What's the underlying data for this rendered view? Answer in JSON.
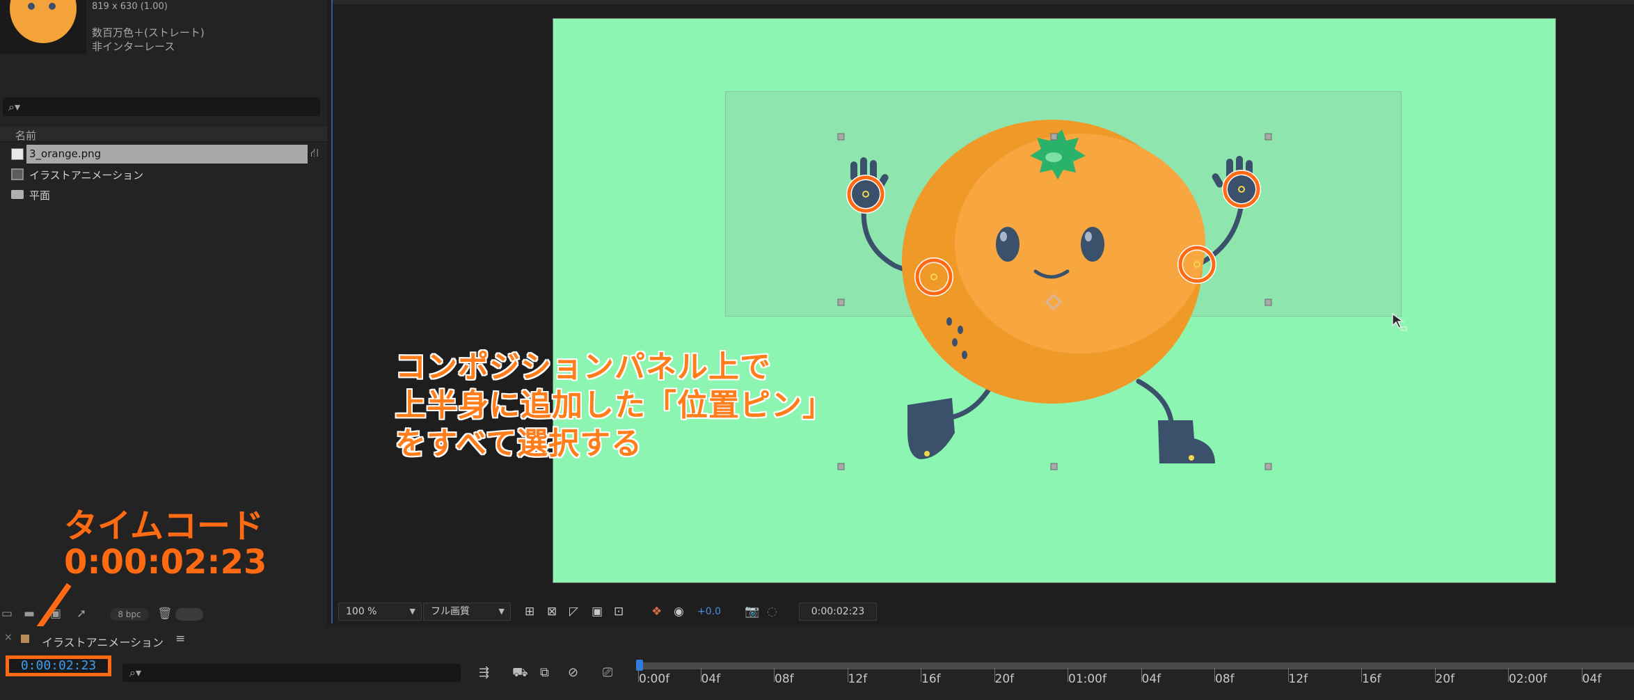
{
  "project_panel": {
    "meta_size": "819 x 630 (1.00)",
    "meta_colors": "数百万色＋(ストレート)",
    "meta_interlace": "非インターレース",
    "search": {
      "placeholder": ""
    },
    "column_name": "名前",
    "items": [
      {
        "label": "3_orange.png",
        "icon": "file-icon",
        "selected": true
      },
      {
        "label": "イラストアニメーション",
        "icon": "composition-icon",
        "selected": false
      },
      {
        "label": "平面",
        "icon": "folder-icon",
        "selected": false
      }
    ],
    "footer": {
      "bpc": "8 bpc"
    }
  },
  "viewer": {
    "canvas_color": "#8bf5b1",
    "zoom": "100 %",
    "resolution": "フル画質",
    "exposure": "+0.0",
    "timecode": "0:00:02:23"
  },
  "annotation": {
    "lines": [
      "コンポジションパネル上で",
      "上半身に追加した「位置ピン」",
      "をすべて選択する"
    ],
    "timecode_label": "タイムコード",
    "timecode_value": "0:00:02:23",
    "accent": "#ff6a13"
  },
  "timeline": {
    "comp_name": "イラストアニメーション",
    "timecode": "0:00:02:23",
    "ticks": [
      "0:00f",
      "04f",
      "08f",
      "12f",
      "16f",
      "20f",
      "01:00f",
      "04f",
      "08f",
      "12f",
      "16f",
      "20f",
      "02:00f",
      "04f"
    ]
  }
}
